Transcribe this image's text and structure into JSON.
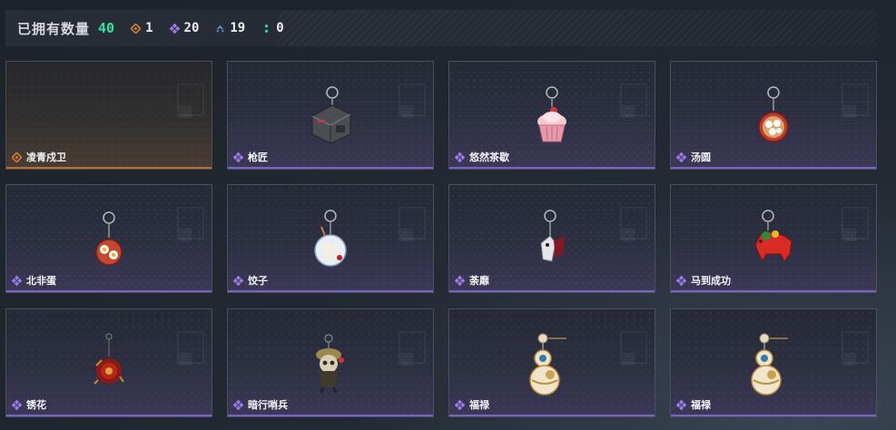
{
  "header": {
    "owned_label": "已拥有数量",
    "owned_count": "40",
    "stats": [
      {
        "icon": "orange-diamond-icon",
        "value": "1",
        "color": "#d07a3c"
      },
      {
        "icon": "purple-diamond-icon",
        "value": "20",
        "color": "#9a7ae8"
      },
      {
        "icon": "blue-chevron-icon",
        "value": "19",
        "color": "#5aa9e6"
      },
      {
        "icon": "green-dots-icon",
        "value": "0",
        "color": "#2fd39a"
      }
    ]
  },
  "items": [
    {
      "name": "凌青戍卫",
      "rarity": "orange",
      "art": "empty"
    },
    {
      "name": "枪匠",
      "rarity": "purple",
      "art": "box-keychain"
    },
    {
      "name": "悠然茶歇",
      "rarity": "purple",
      "art": "cupcake-keychain"
    },
    {
      "name": "汤圆",
      "rarity": "purple",
      "art": "bowl-keychain"
    },
    {
      "name": "北非蛋",
      "rarity": "purple",
      "art": "eggs-keychain"
    },
    {
      "name": "饺子",
      "rarity": "purple",
      "art": "dumpling-keychain"
    },
    {
      "name": "荼靡",
      "rarity": "purple",
      "art": "figure-keychain"
    },
    {
      "name": "马到成功",
      "rarity": "purple",
      "art": "horse-keychain"
    },
    {
      "name": "锈花",
      "rarity": "purple",
      "art": "rose-keychain"
    },
    {
      "name": "暗行哨兵",
      "rarity": "purple",
      "art": "soldier-keychain"
    },
    {
      "name": "福禄",
      "rarity": "purple",
      "art": "gourd-keychain"
    },
    {
      "name": "福禄",
      "rarity": "purple",
      "art": "gourd-keychain"
    }
  ],
  "colors": {
    "accent_green": "#2fe39a",
    "purple_rarity": "#9a7ae8",
    "orange_rarity": "#d07a3c"
  }
}
